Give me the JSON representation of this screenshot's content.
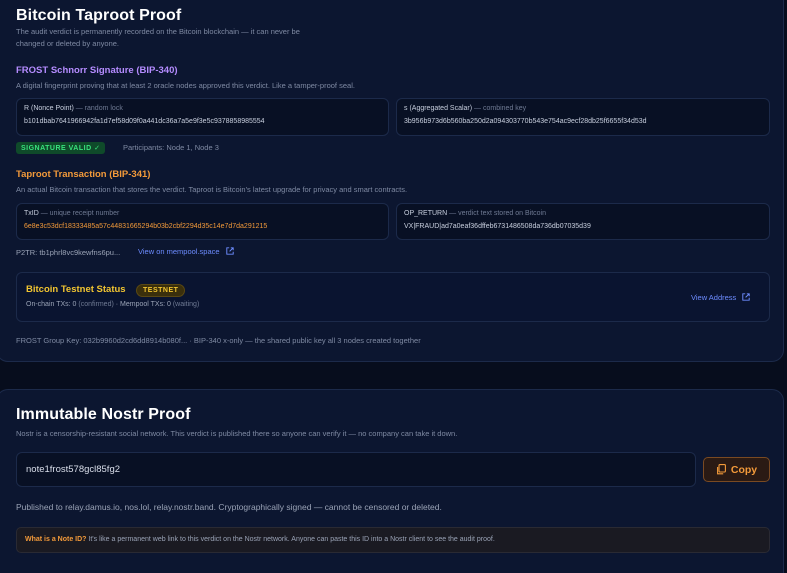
{
  "bitcoin": {
    "title": "Bitcoin Taproot Proof",
    "subtitle_line1": "The audit verdict is permanently recorded on the Bitcoin blockchain — it can never be",
    "subtitle_line2": "changed or deleted by anyone.",
    "frost": {
      "title": "FROST Schnorr Signature (BIP-340)",
      "desc": "A digital fingerprint proving that at least 2 oracle nodes approved this verdict. Like a tamper-proof seal.",
      "r_label": "R (Nonce Point)",
      "r_hint": " — random lock",
      "r_value": "b101dbab7641966942fa1d7ef58d09f0a441dc36a7a5e9f3e5c9378858985554",
      "s_label": "s (Aggregated Scalar)",
      "s_hint": " — combined key",
      "s_value": "3b956b973d6b560ba250d2a094303770b543e754ac9ecf28db25f6655f34d53d",
      "valid_badge": "SIGNATURE VALID ✓",
      "participants": "Participants: Node 1, Node 3"
    },
    "taproot": {
      "title": "Taproot Transaction (BIP-341)",
      "desc": "An actual Bitcoin transaction that stores the verdict. Taproot is Bitcoin's latest upgrade for privacy and smart contracts.",
      "txid_label": "TxID",
      "txid_hint": " — unique receipt number",
      "txid_value": "6e8e3c53dcf18333485a57c44831665294b03b2cbf2294d35c14e7d7da291215",
      "opreturn_label": "OP_RETURN",
      "opreturn_hint": " — verdict text stored on Bitcoin",
      "opreturn_value": "VX|FRAUD|ad7a0eaf36dffeb6731486508da736db07035d39",
      "p2tr": "P2TR: tb1phrl8vc9kewfns6pu...",
      "mempool_link": "View on mempool.space"
    },
    "status": {
      "title": "Bitcoin Testnet Status",
      "badge": "TESTNET",
      "onchain_label": "On-chain TXs: 0",
      "onchain_hint": " (confirmed)",
      "sep": " · ",
      "mempool_label": "Mempool TXs: 0",
      "mempool_hint": " (waiting)",
      "view_address": "View Address"
    },
    "group_key": "FROST Group Key: 032b9960d2cd6dd8914b080f... · BIP-340 x-only — the shared public key all 3 nodes created together"
  },
  "nostr": {
    "title": "Immutable Nostr Proof",
    "desc": "Nostr is a censorship-resistant social network. This verdict is published there so anyone can verify it — no company can take it down.",
    "note_id": "note1frost578gcl85fg2",
    "copy_label": "Copy",
    "published": "Published to relay.damus.io, nos.lol, relay.nostr.band. Cryptographically signed — cannot be censored or deleted.",
    "info_lead": "What is a Note ID?",
    "info_text": " It's like a permanent web link to this verdict on the Nostr network. Anyone can paste this ID into a Nostr client to see the audit proof."
  },
  "colors": {
    "accent_purple": "#b58cff",
    "accent_orange": "#f39a3a",
    "valid_green": "#39e27d",
    "testnet_yellow": "#f2c531",
    "link_blue": "#6d8cff"
  }
}
